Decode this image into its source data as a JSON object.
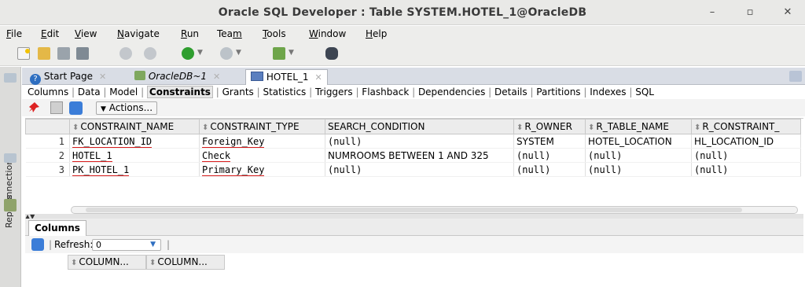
{
  "window": {
    "title": "Oracle SQL Developer : Table SYSTEM.HOTEL_1@OracleDB",
    "minimize_glyph": "–",
    "maximize_glyph": "▫",
    "close_glyph": "✕"
  },
  "menubar": {
    "items": [
      {
        "mn": "F",
        "rest": "ile"
      },
      {
        "mn": "E",
        "rest": "dit"
      },
      {
        "mn": "V",
        "rest": "iew"
      },
      {
        "mn": "N",
        "rest": "avigate"
      },
      {
        "mn": "R",
        "rest": "un"
      },
      {
        "pre": "Tea",
        "mn": "m",
        "rest": ""
      },
      {
        "mn": "T",
        "rest": "ools"
      },
      {
        "mn": "W",
        "rest": "indow"
      },
      {
        "mn": "H",
        "rest": "elp"
      }
    ]
  },
  "left_strip": {
    "connections_label": "Connections",
    "reports_label": "Reports"
  },
  "doc_tabs": {
    "start_page": "Start Page",
    "connection": "OracleDB~1",
    "table": "HOTEL_1"
  },
  "sub_tabs": {
    "items": [
      "Columns",
      "Data",
      "Model",
      "Constraints",
      "Grants",
      "Statistics",
      "Triggers",
      "Flashback",
      "Dependencies",
      "Details",
      "Partitions",
      "Indexes",
      "SQL"
    ],
    "active": "Constraints"
  },
  "actions_label": "Actions...",
  "grid": {
    "columns": [
      "CONSTRAINT_NAME",
      "CONSTRAINT_TYPE",
      "SEARCH_CONDITION",
      "R_OWNER",
      "R_TABLE_NAME",
      "R_CONSTRAINT_"
    ],
    "rows": [
      {
        "num": "1",
        "name": "FK_LOCATION_ID",
        "type": "Foreign_Key",
        "cond": "(null)",
        "r_owner": "SYSTEM",
        "r_table": "HOTEL_LOCATION",
        "r_constraint": "HL_LOCATION_ID"
      },
      {
        "num": "2",
        "name": "HOTEL_1",
        "type": "Check",
        "cond": "NUMROOMS BETWEEN 1 AND 325",
        "r_owner": "(null)",
        "r_table": "(null)",
        "r_constraint": "(null)"
      },
      {
        "num": "3",
        "name": "PK_HOTEL_1",
        "type": "Primary_Key",
        "cond": "(null)",
        "r_owner": "(null)",
        "r_table": "(null)",
        "r_constraint": "(null)"
      }
    ]
  },
  "bottom_panel": {
    "tab": "Columns",
    "refresh_label": "Refresh:",
    "refresh_value": "0",
    "columns": [
      "COLUMN...",
      "COLUMN..."
    ]
  },
  "colors": {
    "annotation_red": "#d81c1c",
    "tab_strip": "#d9dde5"
  }
}
